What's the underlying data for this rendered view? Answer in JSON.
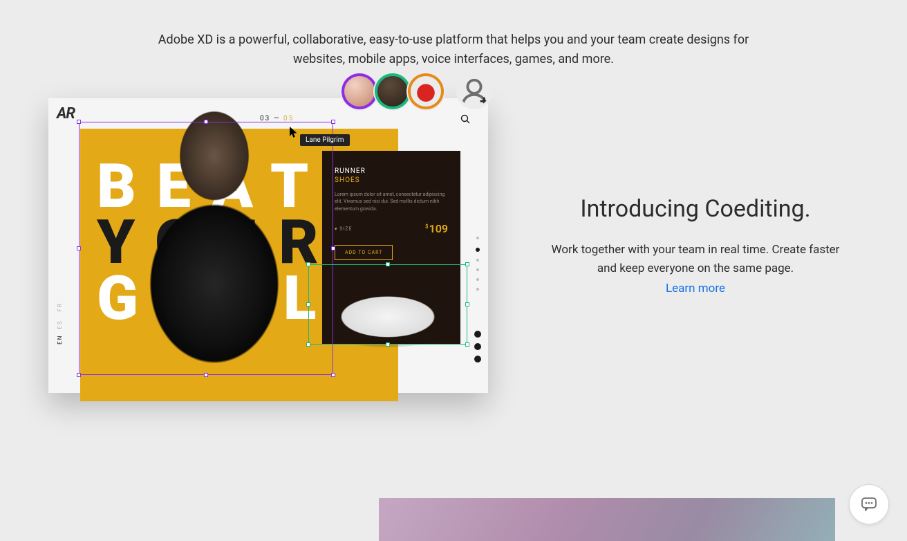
{
  "intro": "Adobe XD is a powerful, collaborative, easy-to-use platform that helps you and your team create designs for websites, mobile apps, voice interfaces, games, and more.",
  "coediting": {
    "heading": "Introducing Coediting.",
    "body": "Work together with your team in real time. Create faster and keep everyone on the same page.",
    "link_label": "Learn more"
  },
  "cursor_user": "Lane Pilgrim",
  "mock": {
    "brand": "AR",
    "pager_current": "03",
    "pager_total": "05",
    "headline_line1": "BEAT",
    "headline_line2": "YOUR",
    "headline_line3": "GOAL",
    "lang_primary": "EN",
    "card": {
      "kicker": "RUNNER",
      "kicker2": "SHOES",
      "lorem": "Lorem ipsum dolor sit amet, consectetur adipiscing elit. Vivamus sed nisi dui. Sed mollis dictum nibh elementum gravida.",
      "size_label": "SIZE",
      "price_currency": "$",
      "price_value": "109",
      "cta": "ADD TO CART"
    }
  }
}
